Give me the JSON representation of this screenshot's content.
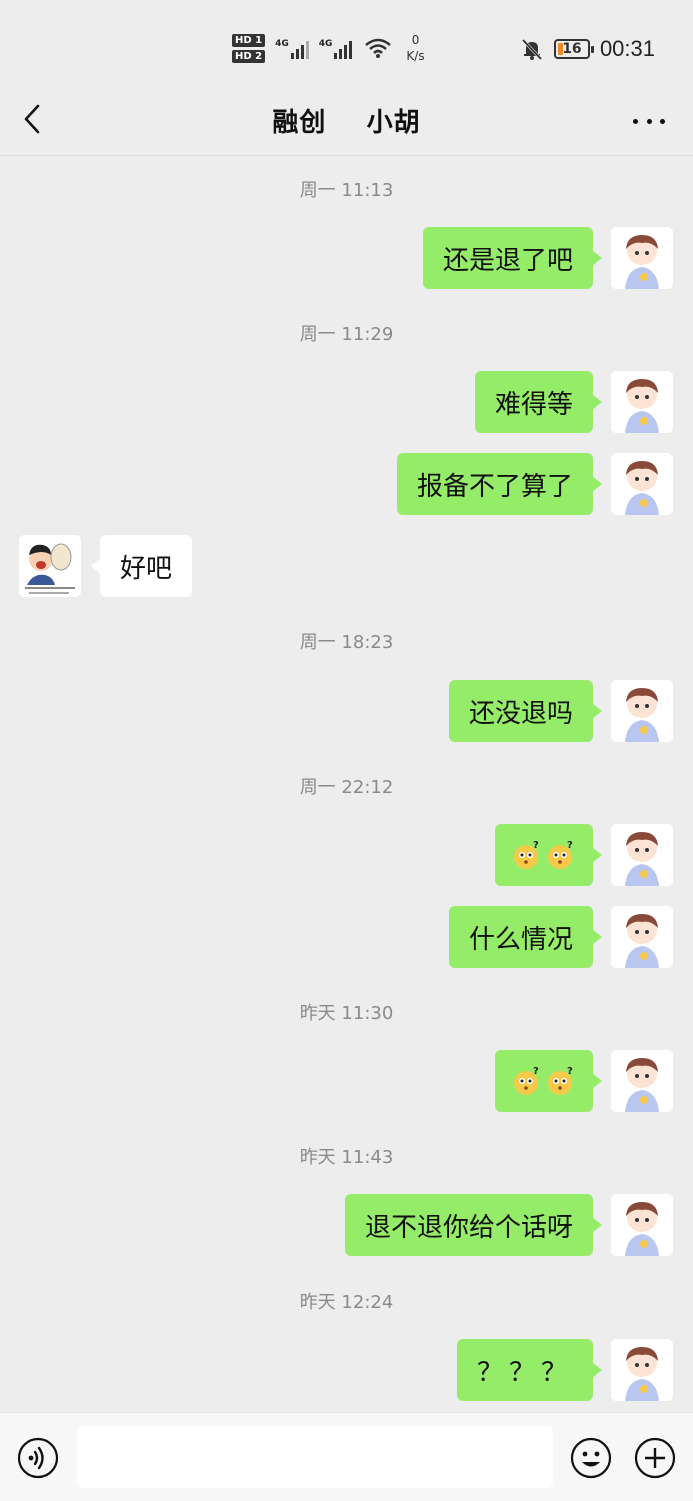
{
  "status_bar": {
    "hd1": "HD 1",
    "hd2": "HD 2",
    "net1": "4G",
    "net2": "4G",
    "speed_value": "0",
    "speed_unit": "K/s",
    "battery": "16",
    "time": "00:31",
    "icons": [
      "signal-icon",
      "wifi-icon",
      "mute-bell-icon",
      "battery-icon"
    ]
  },
  "header": {
    "title": "融创    小胡",
    "back_icon": "chevron-left-icon",
    "more_icon": "more-dots-icon"
  },
  "colors": {
    "background": "#ededed",
    "my_bubble": "#95ec69",
    "other_bubble": "#ffffff",
    "timestamp": "#8a8a8a"
  },
  "messages": [
    {
      "type": "time",
      "text": "周一 11:13"
    },
    {
      "type": "me",
      "text": "还是退了吧"
    },
    {
      "type": "time",
      "text": "周一 11:29"
    },
    {
      "type": "me",
      "text": "难得等"
    },
    {
      "type": "me",
      "text": "报备不了算了"
    },
    {
      "type": "other",
      "text": "好吧"
    },
    {
      "type": "time",
      "text": "周一 18:23"
    },
    {
      "type": "me",
      "text": "还没退吗"
    },
    {
      "type": "time",
      "text": "周一 22:12"
    },
    {
      "type": "me",
      "emoji": "confused-emoji-pair"
    },
    {
      "type": "me",
      "text": "什么情况"
    },
    {
      "type": "time",
      "text": "昨天 11:30"
    },
    {
      "type": "me",
      "emoji": "confused-emoji-pair"
    },
    {
      "type": "time",
      "text": "昨天 11:43"
    },
    {
      "type": "me",
      "text": "退不退你给个话呀"
    },
    {
      "type": "time",
      "text": "昨天 12:24"
    },
    {
      "type": "me",
      "text": "？？？"
    }
  ],
  "input_bar": {
    "voice_icon": "voice-icon",
    "emoji_icon": "emoji-icon",
    "plus_icon": "plus-icon",
    "input_value": ""
  }
}
